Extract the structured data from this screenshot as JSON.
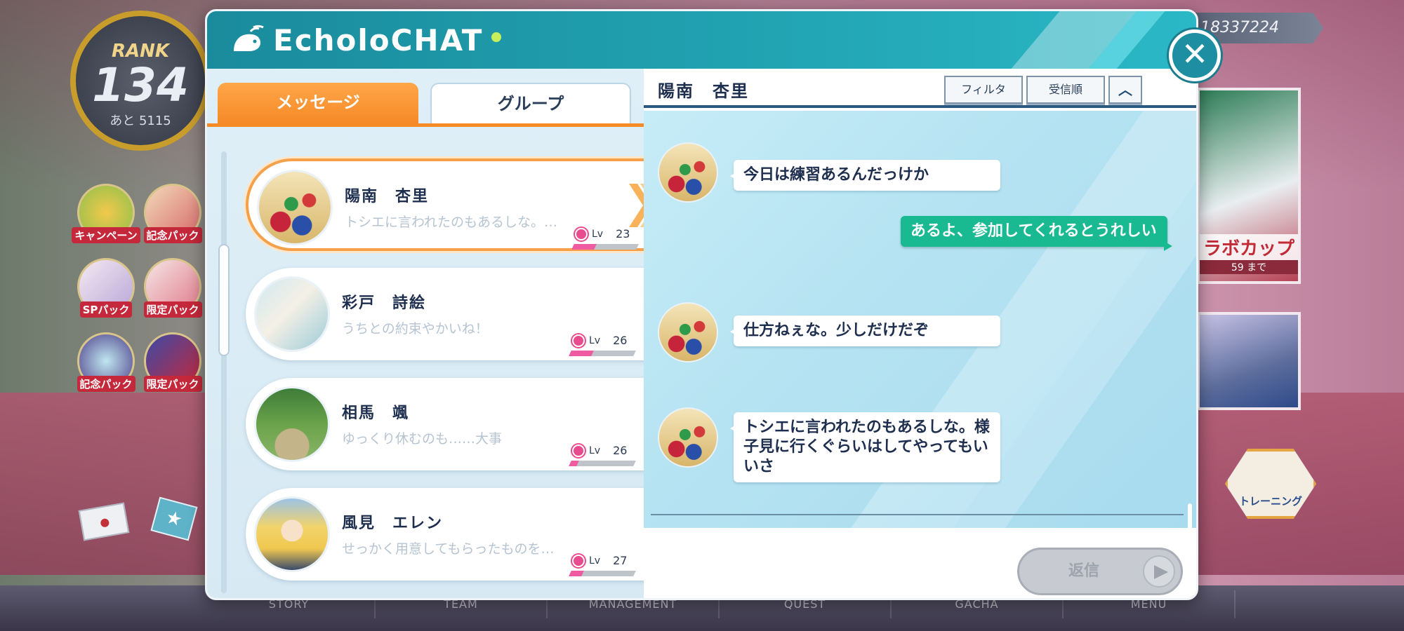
{
  "app": {
    "title": "EcholoCHAT"
  },
  "colors": {
    "accent": "#1fa5b4",
    "tab_active": "#f58a26",
    "outgoing_bubble": "#19b992",
    "heart": "#e84c8e"
  },
  "background": {
    "rank": {
      "label": "RANK",
      "value": "134",
      "next": "あと 5115"
    },
    "currency": "18337224",
    "side_buttons": [
      "キャンペーン",
      "記念パック",
      "SPパック",
      "限定パック",
      "記念パック",
      "限定パック"
    ],
    "banner_collab": {
      "title": "ラボカップ",
      "sub": "59 まで"
    },
    "training_label": "トレーニング",
    "nav": [
      "STORY",
      "TEAM",
      "MANAGEMENT",
      "QUEST",
      "GACHA",
      "MENU"
    ]
  },
  "tabs": {
    "messages": "メッセージ",
    "group": "グループ"
  },
  "contacts": [
    {
      "name": "陽南　杏里",
      "preview": "トシエに言われたのもあるしな。…",
      "lv_label": "Lv",
      "level": "23",
      "affection": 0.35,
      "avatar": "poker-chips"
    },
    {
      "name": "彩戸　詩絵",
      "preview": "うちとの約束やかいね！",
      "lv_label": "Lv",
      "level": "26",
      "affection": 0.35,
      "avatar": "book"
    },
    {
      "name": "相馬　颯",
      "preview": "ゆっくり休むのも……大事",
      "lv_label": "Lv",
      "level": "26",
      "affection": 0.12,
      "avatar": "forest"
    },
    {
      "name": "風見　エレン",
      "preview": "せっかく用意してもらったものを…",
      "lv_label": "Lv",
      "level": "27",
      "affection": 0.2,
      "avatar": "blonde-girl"
    }
  ],
  "chat": {
    "partner": "陽南　杏里",
    "filter_label": "フィルタ",
    "order_label": "受信順",
    "collapse_icon": "chevron-up-icon",
    "messages": [
      {
        "from": "them",
        "text": "今日は練習あるんだっけか"
      },
      {
        "from": "me",
        "text": "あるよ、参加してくれるとうれしい"
      },
      {
        "from": "them",
        "text": "仕方ねぇな。少しだけだぞ"
      },
      {
        "from": "them",
        "text": "トシエに言われたのもあるしな。様子見に行くぐらいはしてやってもいいさ"
      }
    ],
    "reply_label": "返信"
  }
}
